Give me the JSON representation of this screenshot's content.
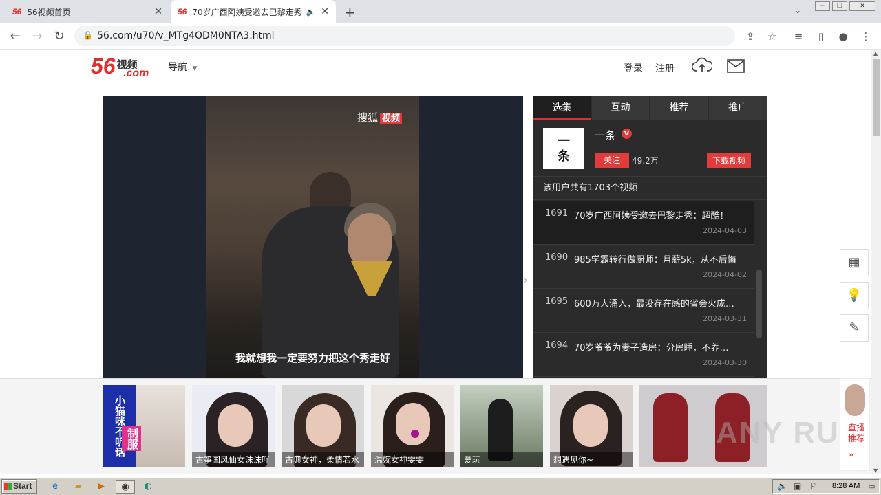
{
  "browser": {
    "tabs": [
      {
        "favicon": "56",
        "title": "56视频首页"
      },
      {
        "favicon": "56",
        "title": "70岁广西阿姨受邀去巴黎走秀"
      }
    ],
    "new_tab": "+",
    "url": "56.com/u70/v_MTg4ODM0NTA3.html"
  },
  "site": {
    "logo_num": "56",
    "logo_cn": "视频",
    "logo_com": ".com",
    "nav_label": "导航",
    "login": "登录",
    "register": "注册"
  },
  "video": {
    "watermark_brand": "搜狐",
    "watermark_tag": "视频",
    "subtitle": "我就想我一定要努力把这个秀走好"
  },
  "panel": {
    "tabs": [
      "选集",
      "互动",
      "推荐",
      "推广"
    ],
    "user": {
      "avatar_text": "一条",
      "name": "一条",
      "verified_badge": "V",
      "follow_label": "关注",
      "followers": "49.2万",
      "download_label": "下载视频"
    },
    "video_count_text": "该用户共有1703个视频",
    "videos": [
      {
        "num": "1691",
        "title": "70岁广西阿姨受邀去巴黎走秀：超酷！",
        "date": "2024-04-03"
      },
      {
        "num": "1690",
        "title": "985学霸转行做厨师：月薪5k，从不后悔",
        "date": "2024-04-02"
      },
      {
        "num": "1695",
        "title": "600万人涌入，最没存在感的省会火成…",
        "date": "2024-03-31"
      },
      {
        "num": "1694",
        "title": "70岁爷爷为妻子造房：分房睡，不养…",
        "date": "2024-03-30"
      }
    ]
  },
  "recommend": [
    {
      "caption": "",
      "banner_text": "小猫咪不听话",
      "banner_text2": "制服"
    },
    {
      "caption": "古筝国风仙女沫沫吖"
    },
    {
      "caption": "古典女神，柔情若水"
    },
    {
      "caption": "温婉女神雯雯"
    },
    {
      "caption": "爱玩"
    },
    {
      "caption": "想遇见你~"
    },
    {
      "caption": ""
    }
  ],
  "live": {
    "label": "直播推荐",
    "arrow": "»"
  },
  "side_icons": [
    "qrcode-icon",
    "lightbulb-icon",
    "edit-icon"
  ],
  "watermark": "ANY RUN",
  "taskbar": {
    "start_label": "Start",
    "clock": "8:28 AM"
  },
  "colors": {
    "brand": "#e32c2c",
    "panel_bg": "#2b2b2b"
  }
}
